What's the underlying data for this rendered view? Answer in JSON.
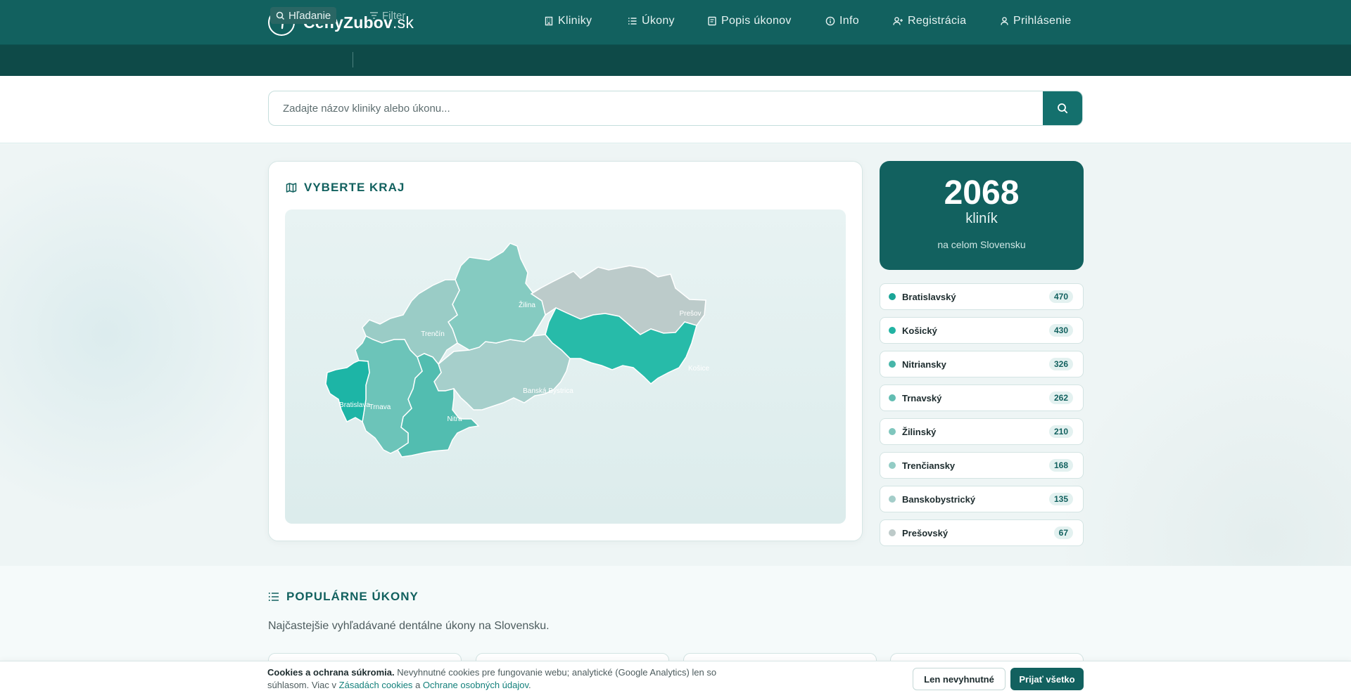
{
  "brand": {
    "name": "CenyZubov",
    "tld": ".sk"
  },
  "nav": {
    "items": [
      {
        "label": "Kliniky",
        "icon": "building-icon"
      },
      {
        "label": "Úkony",
        "icon": "list-icon"
      },
      {
        "label": "Popis úkonov",
        "icon": "book-icon"
      },
      {
        "label": "Info",
        "icon": "info-icon"
      },
      {
        "label": "Registrácia",
        "icon": "user-plus-icon"
      },
      {
        "label": "Prihlásenie",
        "icon": "user-icon"
      }
    ]
  },
  "subbar": {
    "search_label": "Hľadanie",
    "filter_label": "Filter"
  },
  "search": {
    "placeholder": "Zadajte názov kliniky alebo úkonu..."
  },
  "map_card": {
    "title": "VYBERTE KRAJ",
    "regions": [
      {
        "label": "Bratislava",
        "color": "#1db5a6"
      },
      {
        "label": "Trnava",
        "color": "#6cc4b9"
      },
      {
        "label": "Nitra",
        "color": "#52bdb0"
      },
      {
        "label": "Trenčín",
        "color": "#9accc6"
      },
      {
        "label": "Žilina",
        "color": "#85cbc1"
      },
      {
        "label": "Banská Bystrica",
        "color": "#a6cfcb"
      },
      {
        "label": "Prešov",
        "color": "#bccbca"
      },
      {
        "label": "Košice",
        "color": "#27bba9"
      }
    ]
  },
  "stats": {
    "count": "2068",
    "unit": "kliník",
    "subtitle": "na celom Slovensku"
  },
  "region_list": [
    {
      "name": "Bratislavský",
      "count": "470",
      "color": "#1aa597"
    },
    {
      "name": "Košický",
      "count": "430",
      "color": "#22b3a3"
    },
    {
      "name": "Nitriansky",
      "count": "326",
      "color": "#47b6a9"
    },
    {
      "name": "Trnavský",
      "count": "262",
      "color": "#62bdb2"
    },
    {
      "name": "Žilinský",
      "count": "210",
      "color": "#7fc6bd"
    },
    {
      "name": "Trenčiansky",
      "count": "168",
      "color": "#93ccc5"
    },
    {
      "name": "Banskobystrický",
      "count": "135",
      "color": "#a4cdc9"
    },
    {
      "name": "Prešovský",
      "count": "67",
      "color": "#bdcac9"
    }
  ],
  "popular": {
    "title": "POPULÁRNE ÚKONY",
    "subtitle": "Najčastejšie vyhľadávané dentálne úkony na Slovensku."
  },
  "cookie": {
    "title": "Cookies a ochrana súkromia.",
    "text_1": "Nevyhnutné cookies pre fungovanie webu; analytické (Google Analytics) len so súhlasom. Viac v",
    "link_1": "Zásadách cookies",
    "and": "a",
    "link_2": "Ochrane osobných údajov",
    "end": ".",
    "btn_necessary": "Len nevyhnutné",
    "btn_accept": "Prijať všetko"
  }
}
